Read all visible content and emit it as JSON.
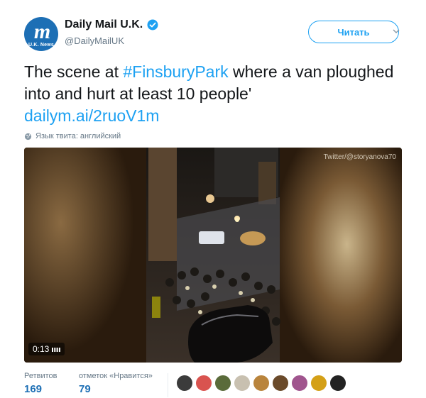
{
  "account": {
    "name": "Daily Mail U.K.",
    "handle": "@DailyMailUK",
    "avatar_text": "m",
    "avatar_subtext": "U.K. News",
    "brand_color": "#1d6fb5",
    "verified_icon": "verified-badge-icon"
  },
  "follow": {
    "label": "Читать"
  },
  "tweet": {
    "text_before": "The scene at ",
    "hashtag": "#FinsburyPark",
    "text_after": " where a van ploughed into and hurt at least 10 people'",
    "link": "dailym.ai/2ruoV1m",
    "link_color": "#1da1f2"
  },
  "language_note": "Язык твита: английский",
  "video": {
    "watermark": "Twitter/@storyanova70",
    "duration": "0:13"
  },
  "stats": {
    "retweets_label": "Ретвитов",
    "retweets_value": "169",
    "likes_label": "отметок «Нравится»",
    "likes_value": "79"
  },
  "likers": [
    {
      "color": "#3b3b3b"
    },
    {
      "color": "#d9534f"
    },
    {
      "color": "#5a6b3a"
    },
    {
      "color": "#c8c0b0"
    },
    {
      "color": "#b9843c"
    },
    {
      "color": "#6a4a2a"
    },
    {
      "color": "#a0558e"
    },
    {
      "color": "#d4a017"
    },
    {
      "color": "#222222"
    }
  ]
}
